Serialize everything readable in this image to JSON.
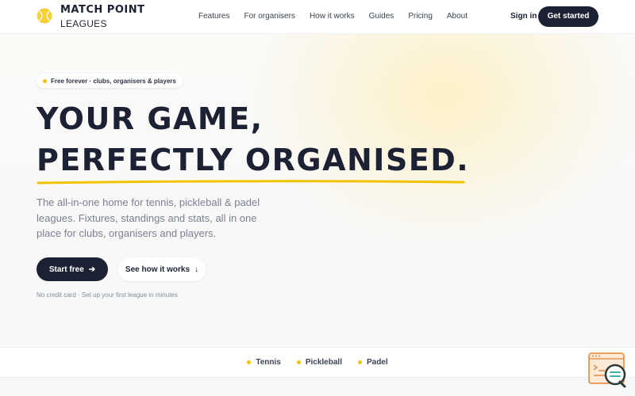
{
  "brand": {
    "name_top": "MATCH POINT",
    "name_bottom": "LEAGUES",
    "accent_color": "#f2c200",
    "dark_color": "#1c2233"
  },
  "nav": {
    "items": [
      "Features",
      "For organisers",
      "How it works",
      "Guides",
      "Pricing",
      "About"
    ],
    "sign_in": "Sign in",
    "get_started": "Get started"
  },
  "hero": {
    "badge": "Free forever · clubs, organisers & players",
    "headline_line1": "YOUR GAME,",
    "headline_line2": "PERFECTLY ORGANISED.",
    "lead": "The all-in-one home for tennis, pickleball & padel leagues. Fixtures, standings and stats, all in one place for clubs, organisers and players.",
    "primary_cta": "Start free",
    "secondary_cta": "See how it works",
    "note": "No credit card · Set up your first league in minutes"
  },
  "sports": [
    "Tennis",
    "Pickleball",
    "Padel"
  ],
  "icons": {
    "logo": "tennis-ball-icon",
    "primary_arrow": "arrow-right-icon",
    "secondary_arrow": "arrow-down-icon",
    "widget": "chat-support-icon"
  }
}
